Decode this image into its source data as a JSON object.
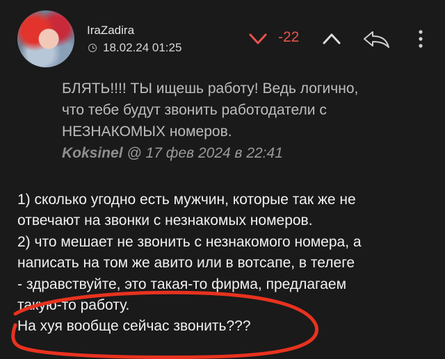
{
  "post": {
    "username": "IraZadira",
    "timestamp": "18.02.24 01:25",
    "score": "-22",
    "icons": {
      "vote_down": "chevron-down-icon",
      "vote_up": "chevron-up-icon",
      "reply": "reply-icon",
      "more": "more-vertical-icon",
      "time": "clock-icon"
    },
    "colors": {
      "background": "#1a1a1a",
      "score": "#e8534d",
      "vote_down": "#e8534d",
      "scribble": "#e8321f"
    }
  },
  "quote": {
    "lines": [
      "БЛЯТЬ!!!! ТЫ ищешь работу! Ведь логично,",
      "что тебе будут звонить работодатели с",
      "НЕЗНАКОМЫХ номеров."
    ],
    "author": "Koksinel",
    "date": "@ 17 фев 2024 в 22:41"
  },
  "comment": {
    "lines": [
      "1) сколько угодно есть мужчин, которые так же не",
      "отвечают на звонки с незнакомых номеров.",
      "2) что мешает не звонить с незнакомого номера, а",
      "написать на том же авито или в вотсапе, в телеге",
      "- здравствуйте, это такая-то фирма, предлагаем",
      "такую-то работу.",
      "На хуя вообще сейчас звонить???"
    ]
  }
}
